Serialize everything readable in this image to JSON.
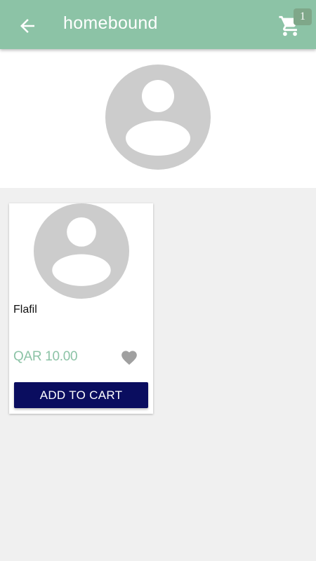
{
  "appbar": {
    "title": "homebound",
    "back_icon": "arrow-back-icon",
    "cart_icon": "shopping-cart-icon",
    "cart_count": "1",
    "background": "#8cc3a6"
  },
  "banner": {
    "image": "avatar-placeholder-icon"
  },
  "products": [
    {
      "name": "Flafil",
      "price": "QAR 10.00",
      "image": "avatar-placeholder-icon",
      "favorite_icon": "heart-icon",
      "add_to_cart_label": "ADD TO CART"
    }
  ],
  "colors": {
    "accent": "#8cc3a6",
    "button": "#0a0d5f",
    "placeholder": "#cccccc",
    "page_background": "#f0f0f0"
  }
}
